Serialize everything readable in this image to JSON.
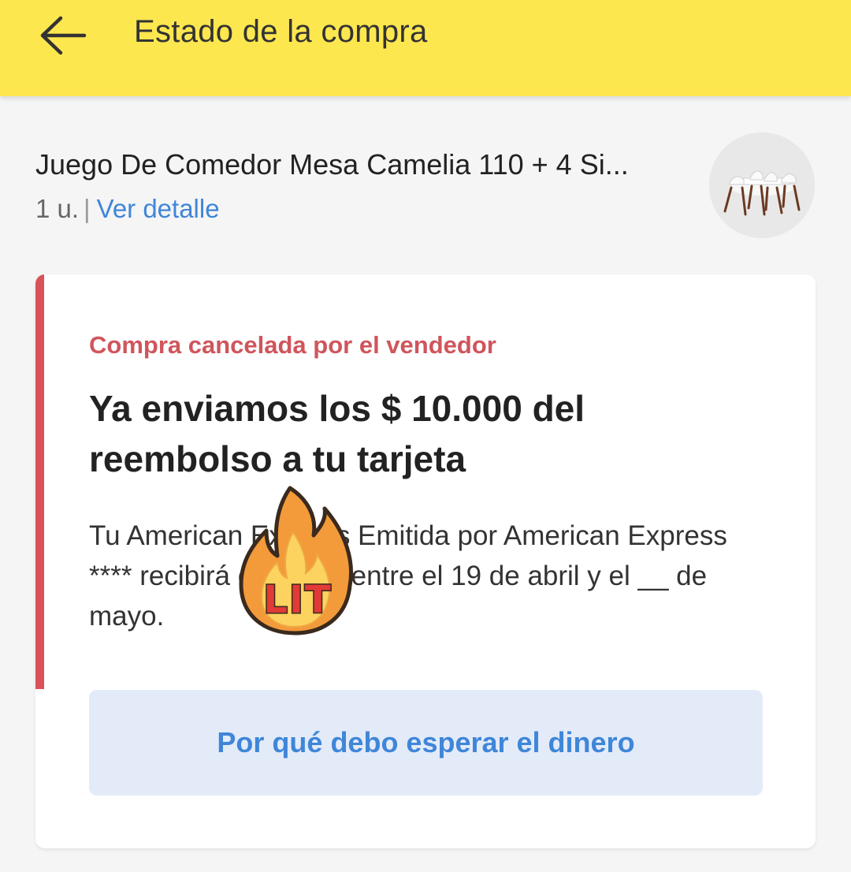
{
  "header": {
    "title": "Estado de la compra",
    "back_icon": "arrow-left-icon",
    "background": "#fde74f"
  },
  "product": {
    "title": "Juego De Comedor Mesa Camelia 110 + 4 Si...",
    "quantity": "1 u.",
    "separator": "|",
    "detail_link": "Ver detalle",
    "thumbnail": "dining-set-thumbnail"
  },
  "status_card": {
    "status": "Compra cancelada por el vendedor",
    "headline": "Ya enviamos los $ 10.000 del reembolso a tu tarjeta",
    "body": "Tu American Express Emitida por American Express **** recibirá el dinero entre el 19 de abril y el __ de mayo.",
    "cta_label": "Por qué debo esperar el dinero",
    "accent_color": "#d9525a"
  },
  "sticker": {
    "text": "LIT",
    "icon": "fire-sticker"
  },
  "colors": {
    "link": "#3f86d8",
    "status_red": "#d0555c",
    "cta_bg": "#e3ebf9"
  }
}
